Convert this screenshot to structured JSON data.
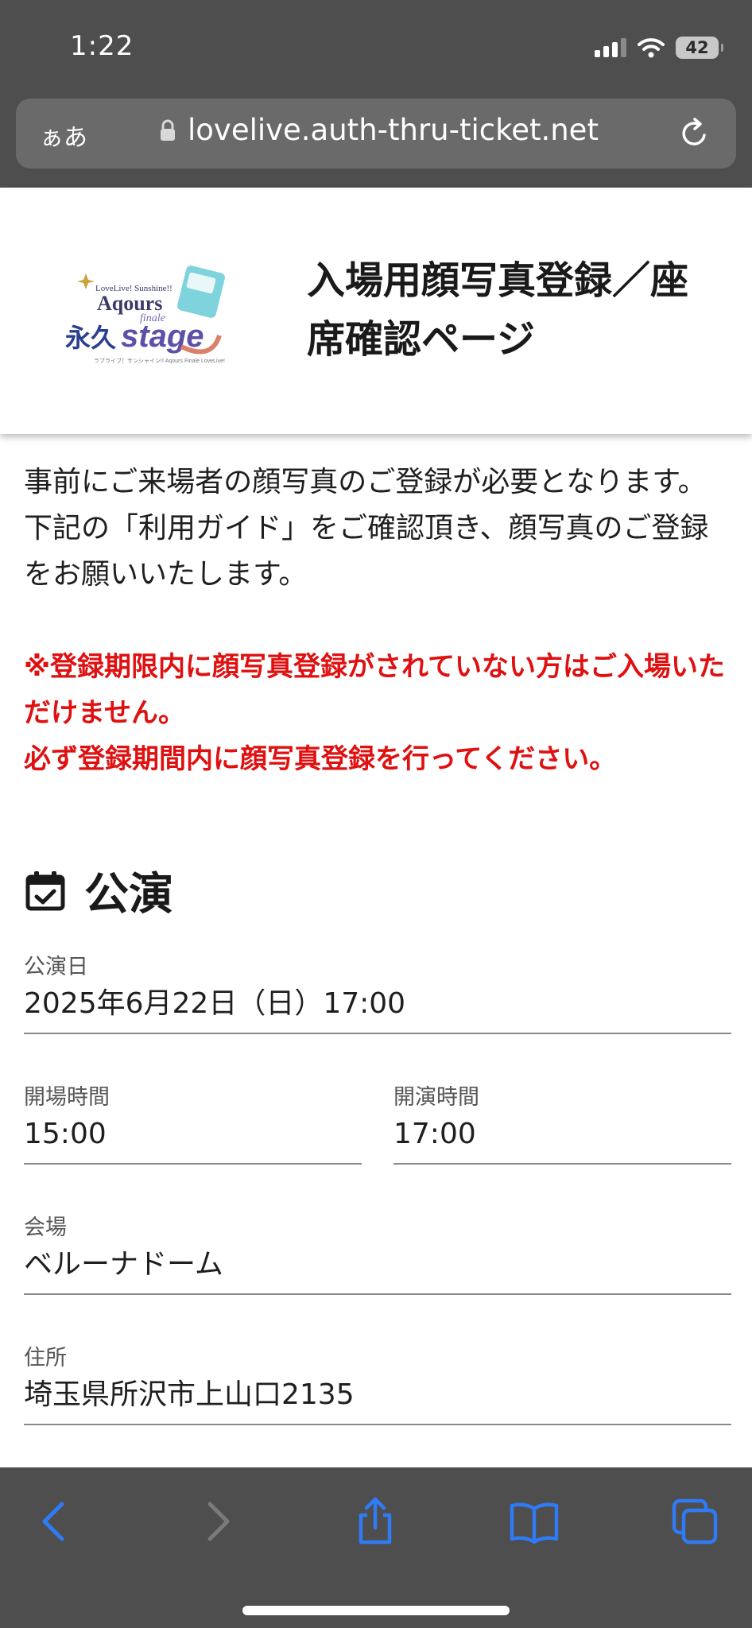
{
  "status_bar": {
    "time": "1:22",
    "battery": "42"
  },
  "browser": {
    "aa_label": "ぁあ",
    "url": "lovelive.auth-thru-ticket.net"
  },
  "header": {
    "logo_text": "Aqours 永久stage",
    "title": "入場用顔写真登録／座席確認ページ"
  },
  "notice": {
    "intro_1": "事前にご来場者の顔写真のご登録が必要となります。",
    "intro_2": "下記の「利用ガイド」をご確認頂き、顔写真のご登録をお願いいたします。",
    "warning_1": "※登録期限内に顔写真登録がされていない方はご入場いただけません。",
    "warning_2": "必ず登録期間内に顔写真登録を行ってください。"
  },
  "performance": {
    "heading": "公演",
    "date_label": "公演日",
    "date_value": "2025年6月22日（日）17:00",
    "open_label": "開場時間",
    "open_value": "15:00",
    "start_label": "開演時間",
    "start_value": "17:00",
    "venue_label": "会場",
    "venue_value": "ベルーナドーム",
    "address_label": "住所",
    "address_value": "埼玉県所沢市上山口2135"
  },
  "colors": {
    "warning": "#e01010",
    "chrome": "#4e4e4e",
    "toolbar_icon": "#2f7bf5"
  },
  "toolbar": {
    "icons": [
      "back-icon",
      "forward-icon",
      "share-icon",
      "bookmarks-icon",
      "tabs-icon"
    ]
  }
}
